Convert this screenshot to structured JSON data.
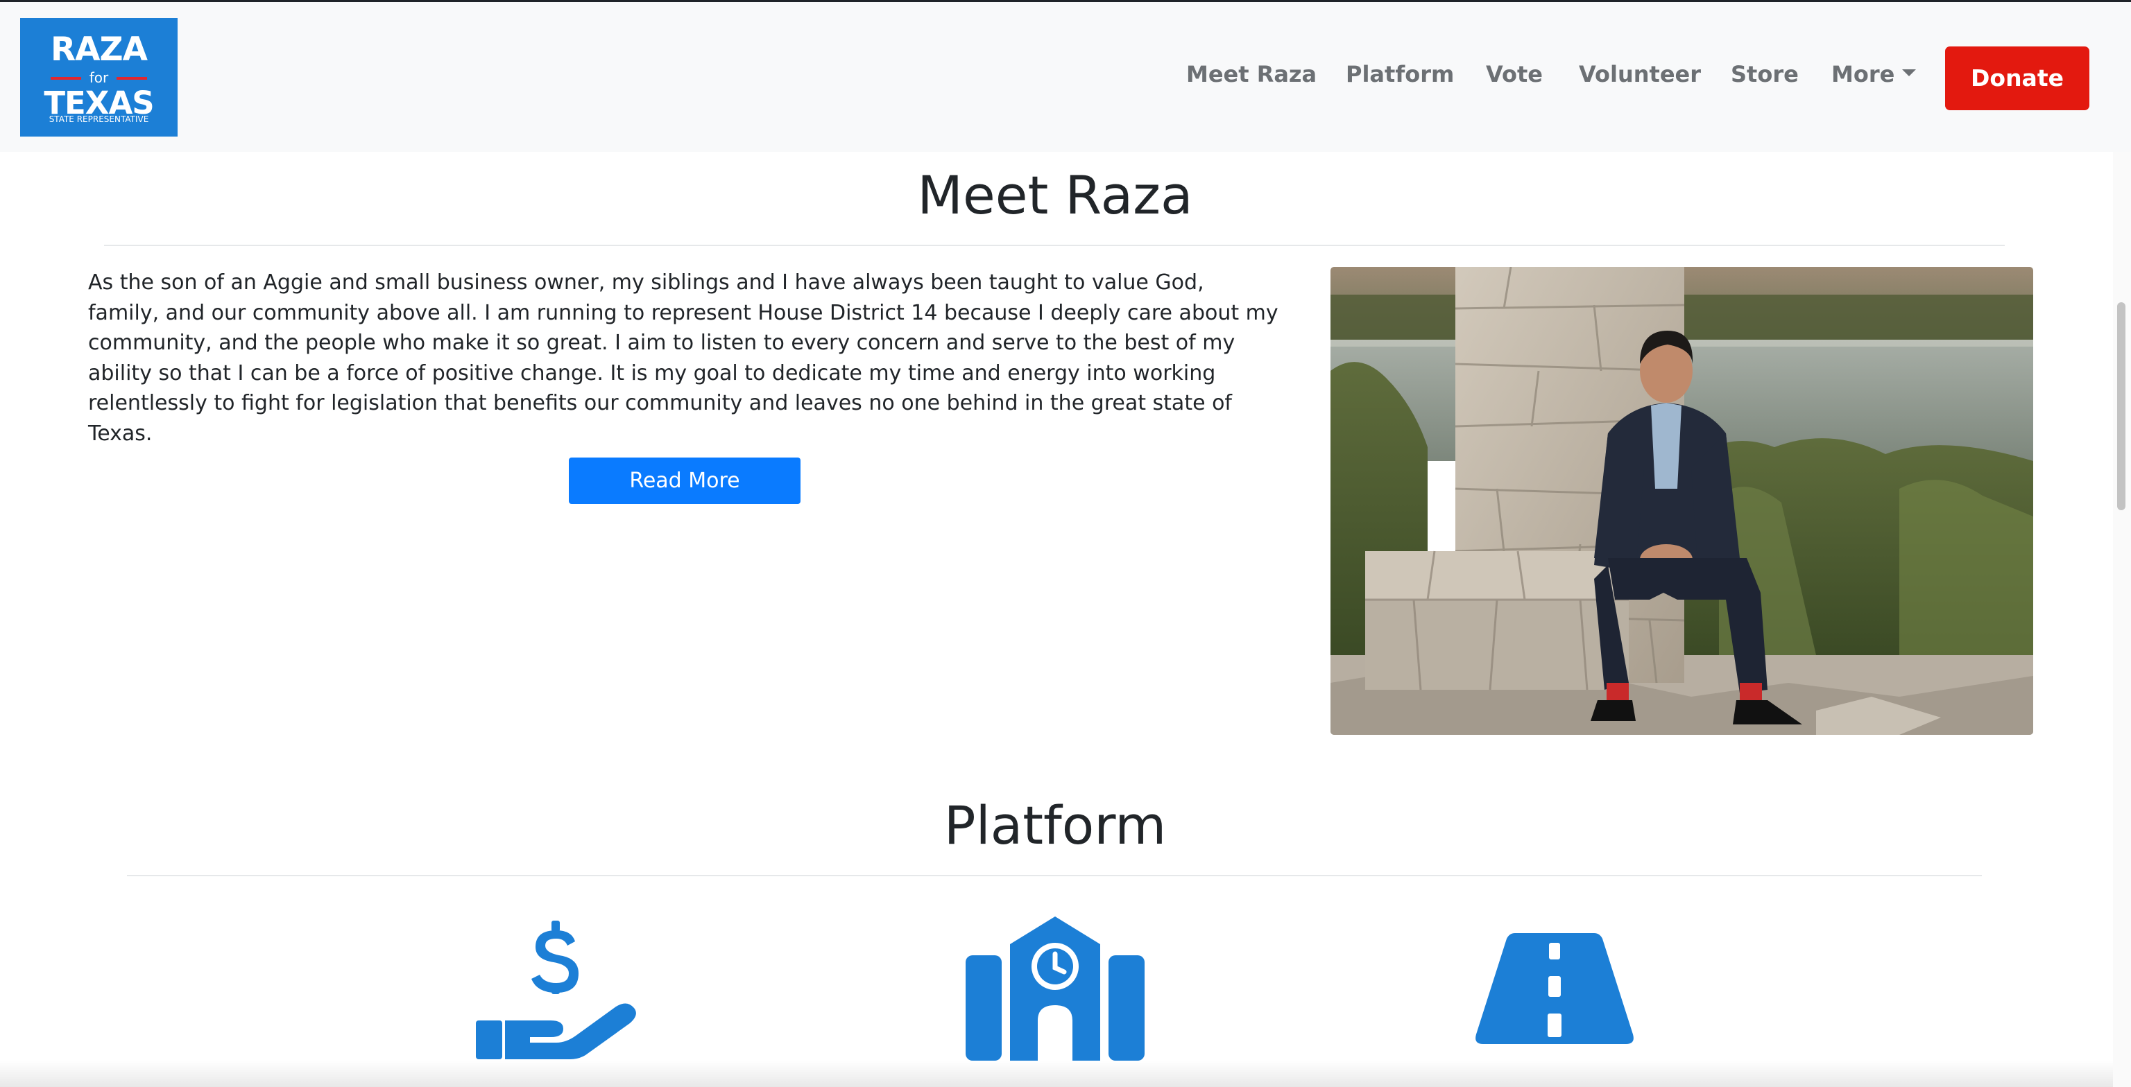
{
  "logo": {
    "line1": "RAZA",
    "line2": "for",
    "line3": "TEXAS",
    "line4": "STATE REPRESENTATIVE"
  },
  "nav": {
    "links": [
      "Meet Raza",
      "Platform",
      "Vote",
      "Volunteer",
      "Store",
      "More"
    ],
    "donate_label": "Donate"
  },
  "meet": {
    "title": "Meet Raza",
    "body": "As the son of an Aggie and small business owner, my siblings and I have always been taught to value God, family, and our community above all. I am running to represent House District 14 because I deeply care about my community, and the people who make it so great. I aim to listen to every concern and serve to the best of my ability so that I can be a force of positive change. It is my goal to dedicate my time and energy into working relentlessly to fight for legislation that benefits our community and leaves no one behind in the great state of Texas.",
    "read_more_label": "Read More"
  },
  "platform": {
    "title": "Platform",
    "icons": [
      "hand-dollar-icon",
      "school-clock-icon",
      "road-icon"
    ]
  },
  "colors": {
    "brand_blue": "#1c7fd6",
    "donate_red": "#e3190f",
    "button_blue": "#0a7bff",
    "icon_blue": "#1c7fd6"
  }
}
